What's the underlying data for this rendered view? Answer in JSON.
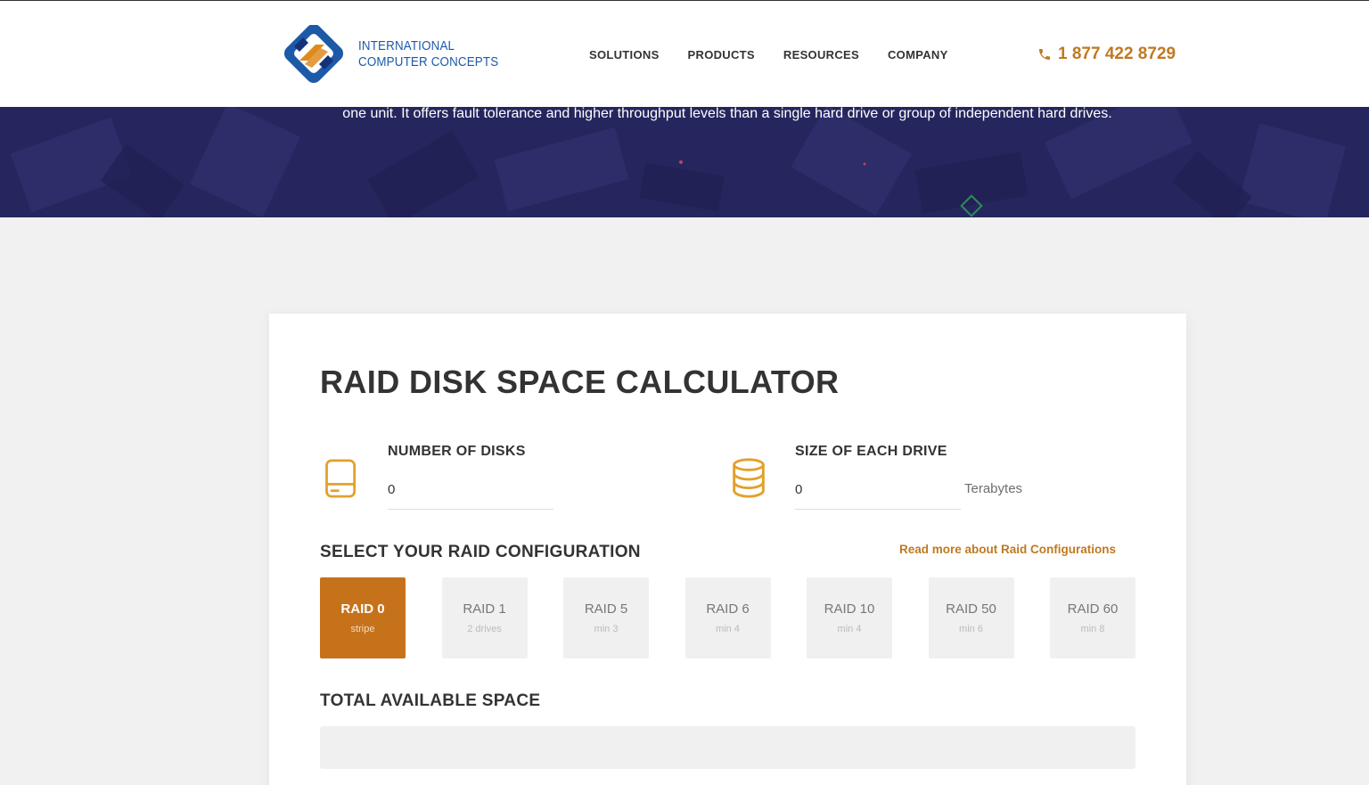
{
  "header": {
    "logo_line1": "INTERNATIONAL",
    "logo_line2": "COMPUTER CONCEPTS",
    "nav": [
      "SOLUTIONS",
      "PRODUCTS",
      "RESOURCES",
      "COMPANY"
    ],
    "phone": "1 877 422 8729"
  },
  "hero": {
    "text": "one unit. It offers fault tolerance and higher throughput levels than a single hard drive or group of independent hard drives."
  },
  "calculator": {
    "title": "RAID DISK SPACE CALCULATOR",
    "disks": {
      "label": "NUMBER OF DISKS",
      "value": "0"
    },
    "drive_size": {
      "label": "SIZE OF EACH DRIVE",
      "value": "0",
      "unit": "Terabytes"
    },
    "config_title": "SELECT YOUR RAID CONFIGURATION",
    "read_more": "Read more about Raid Configurations",
    "raids": [
      {
        "name": "RAID 0",
        "sub": "stripe"
      },
      {
        "name": "RAID 1",
        "sub": "2 drives"
      },
      {
        "name": "RAID 5",
        "sub": "min 3"
      },
      {
        "name": "RAID 6",
        "sub": "min 4"
      },
      {
        "name": "RAID 10",
        "sub": "min 4"
      },
      {
        "name": "RAID 50",
        "sub": "min 6"
      },
      {
        "name": "RAID 60",
        "sub": "min 8"
      }
    ],
    "selected_raid": "RAID 0",
    "total_title": "TOTAL AVAILABLE SPACE",
    "total_value": ""
  },
  "colors": {
    "accent": "#c6721b",
    "hero_bg": "#26265e",
    "logo_blue": "#1c5aa8"
  },
  "icons": [
    "logo-icon",
    "phone-icon",
    "hard-drive-icon",
    "database-icon"
  ]
}
